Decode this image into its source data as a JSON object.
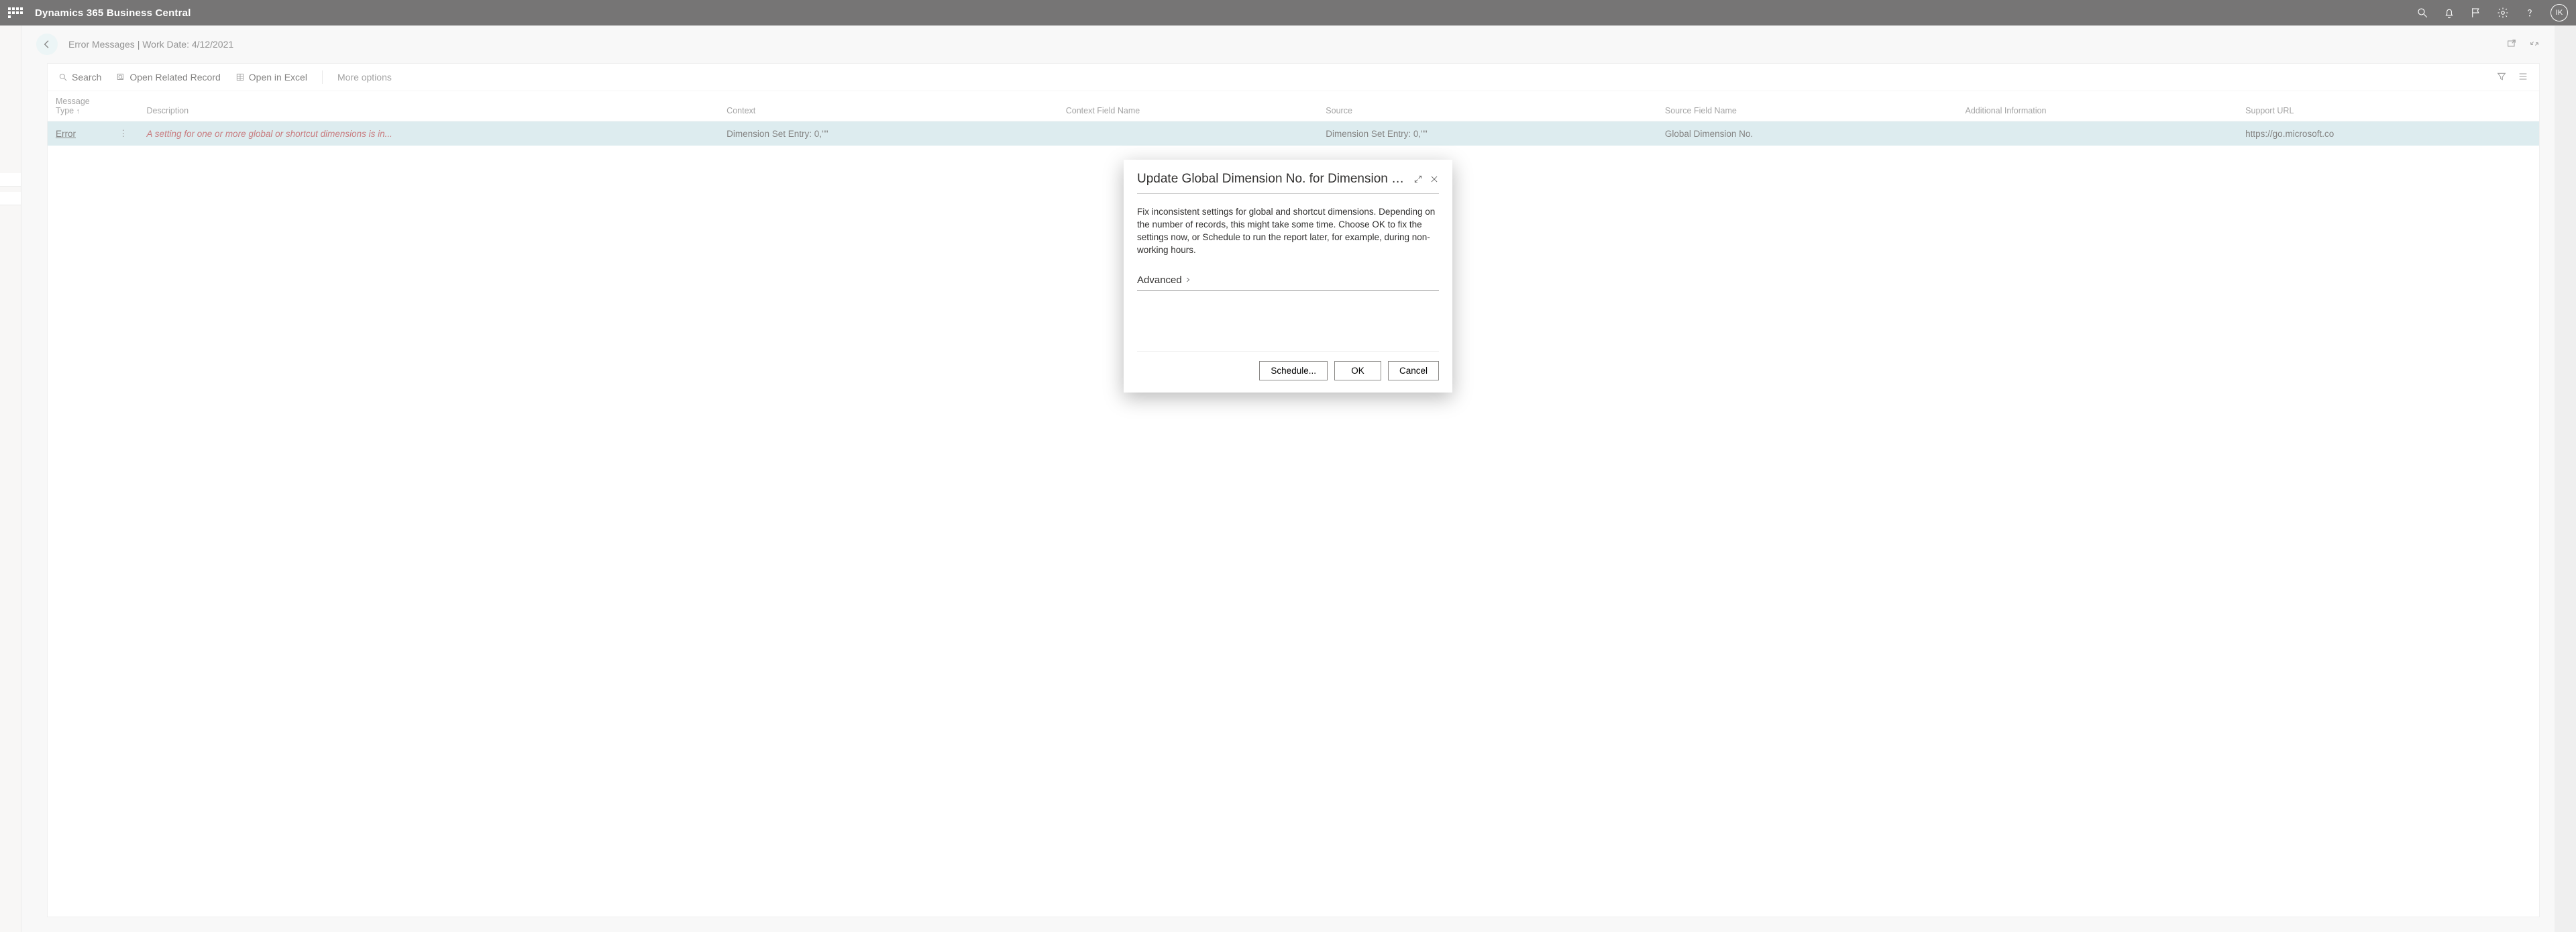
{
  "topbar": {
    "app_title": "Dynamics 365 Business Central",
    "avatar_initials": "IK"
  },
  "page": {
    "title": "Error Messages | Work Date: 4/12/2021"
  },
  "actions": {
    "search": "Search",
    "open_related": "Open Related Record",
    "open_excel": "Open in Excel",
    "more": "More options"
  },
  "table": {
    "headers": {
      "message_type": "Message\nType",
      "description": "Description",
      "context": "Context",
      "context_field": "Context Field Name",
      "source": "Source",
      "source_field": "Source Field Name",
      "additional": "Additional Information",
      "support": "Support URL"
    },
    "rows": [
      {
        "message_type": "Error",
        "description": "A setting for one or more global or shortcut dimensions is in...",
        "context": "Dimension Set Entry: 0,\"\"",
        "context_field": "",
        "source": "Dimension Set Entry: 0,\"\"",
        "source_field": "Global Dimension No.",
        "additional": "",
        "support": "https://go.microsoft.co"
      }
    ]
  },
  "dialog": {
    "title": "Update Global Dimension No. for Dimension Set E...",
    "body": "Fix inconsistent settings for global and shortcut dimensions. Depending on the number of records, this might take some time. Choose OK to fix the settings now, or Schedule to run the report later, for example, during non-working hours.",
    "advanced": "Advanced",
    "buttons": {
      "schedule": "Schedule...",
      "ok": "OK",
      "cancel": "Cancel"
    }
  }
}
